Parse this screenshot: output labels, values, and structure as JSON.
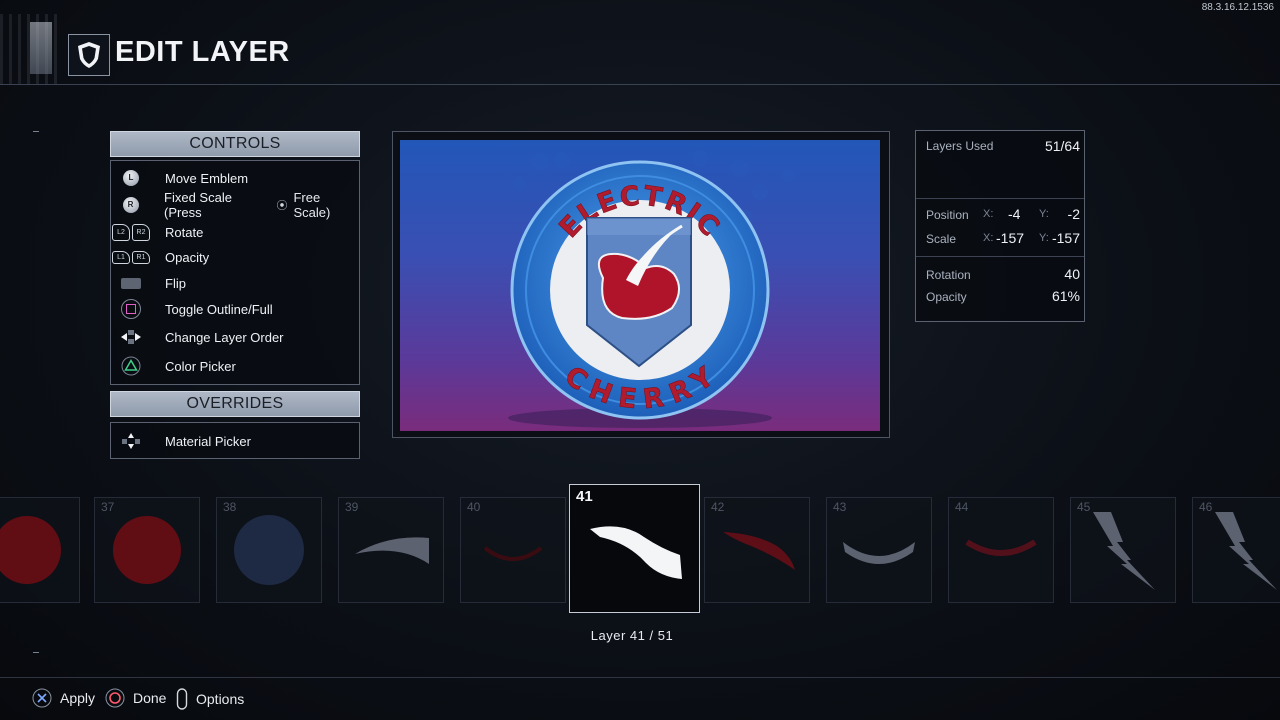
{
  "header": {
    "title": "EDIT LAYER",
    "version": "88.3.16.12.1536"
  },
  "controls": {
    "heading": "CONTROLS",
    "items": [
      {
        "label": "Move Emblem",
        "icon": "left-stick-icon"
      },
      {
        "label": "Fixed Scale (Press",
        "suffix": "Free Scale)",
        "icon": "right-stick-icon"
      },
      {
        "label": "Rotate",
        "icon": "l2-r2-icon"
      },
      {
        "label": "Opacity",
        "icon": "l1-r1-icon"
      },
      {
        "label": "Flip",
        "icon": "touchpad-icon"
      },
      {
        "label": "Toggle Outline/Full",
        "icon": "square-button-icon"
      },
      {
        "label": "Change Layer Order",
        "icon": "dpad-left-right-icon"
      },
      {
        "label": "Color Picker",
        "icon": "triangle-button-icon"
      }
    ]
  },
  "overrides": {
    "heading": "OVERRIDES",
    "items": [
      {
        "label": "Material Picker",
        "icon": "dpad-up-down-icon"
      }
    ]
  },
  "emblem": {
    "top_text": "ELECTRIC",
    "bottom_text": "CHERRY",
    "colors": {
      "bg_top": "#2257b8",
      "bg_bottom": "#7a2c7c",
      "ring": "#2f7fd6",
      "text_red": "#b01c2e",
      "cherry": "#b0142a"
    }
  },
  "stats": {
    "layers_used_label": "Layers Used",
    "layers_used_value": "51/64",
    "position_label": "Position",
    "position_x_label": "X:",
    "position_x": "-4",
    "position_y_label": "Y:",
    "position_y": "-2",
    "scale_label": "Scale",
    "scale_x_label": "X:",
    "scale_x": "-157",
    "scale_y_label": "Y:",
    "scale_y": "-157",
    "rotation_label": "Rotation",
    "rotation_value": "40",
    "opacity_label": "Opacity",
    "opacity_value": "61%"
  },
  "layers": {
    "strip": [
      {
        "num": "",
        "shape": "red-circle"
      },
      {
        "num": "37",
        "shape": "red-circle"
      },
      {
        "num": "38",
        "shape": "blue-circle"
      },
      {
        "num": "39",
        "shape": "grey-swoosh"
      },
      {
        "num": "40",
        "shape": "dark-red-arc"
      },
      {
        "num": "42",
        "shape": "red-swoosh"
      },
      {
        "num": "43",
        "shape": "grey-arc"
      },
      {
        "num": "44",
        "shape": "red-arc"
      },
      {
        "num": "45",
        "shape": "lightning"
      },
      {
        "num": "46",
        "shape": "lightning"
      }
    ],
    "selected_num": "41",
    "caption": "Layer 41 / 51"
  },
  "footer": {
    "apply": "Apply",
    "done": "Done",
    "options": "Options"
  }
}
